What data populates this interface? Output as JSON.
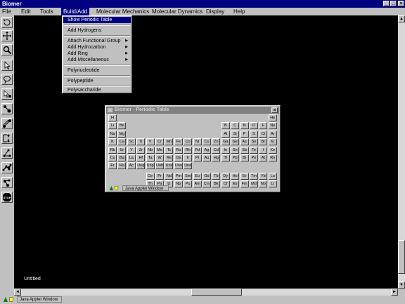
{
  "window": {
    "title": "Biomer"
  },
  "menubar": {
    "items": [
      "File",
      "Edit",
      "Tools",
      "Build/Add",
      "Molecular Mechanics",
      "Molecular Dynamics",
      "Display",
      "Help"
    ]
  },
  "dropdown": {
    "items": [
      {
        "label": "Show Periodic Table",
        "submenu": false,
        "highlighted": true
      },
      {
        "label": "Add Hydrogens",
        "submenu": false
      },
      {
        "label": "Attach Functional Group",
        "submenu": true
      },
      {
        "label": "Add Hydrocarbon",
        "submenu": true
      },
      {
        "label": "Add Ring",
        "submenu": true
      },
      {
        "label": "Add Miscellaneous",
        "submenu": true
      },
      {
        "label": "Polynucleotide",
        "submenu": false
      },
      {
        "label": "Polypeptide",
        "submenu": false
      },
      {
        "label": "Polysaccharide",
        "submenu": false
      }
    ]
  },
  "toolbar": {
    "tools": [
      "rotate-icon",
      "move-icon",
      "zoom-icon",
      "select-arrow-icon",
      "lasso-select-icon",
      "select-atom-icon",
      "add-atom-icon",
      "edit-bond-icon",
      "measure-distance-icon",
      "measure-angle-icon",
      "measure-torsion-icon",
      "molecule-icon",
      "stop-icon"
    ]
  },
  "toolbar_icon_text": {
    "stop": "STOP"
  },
  "canvas": {
    "document_name": "Untitled",
    "background": "#000000"
  },
  "status": {
    "applet_label": "Java Applet Window"
  },
  "periodic_table": {
    "title": "Biomer - Periodic Table",
    "close": "×",
    "status_label": "Java Applet Window",
    "rows": [
      [
        "H",
        "",
        "",
        "",
        "",
        "",
        "",
        "",
        "",
        "",
        "",
        "",
        "",
        "",
        "",
        "",
        "",
        "He"
      ],
      [
        "Li",
        "Be",
        "",
        "",
        "",
        "",
        "",
        "",
        "",
        "",
        "",
        "",
        "B",
        "C",
        "N",
        "O",
        "F",
        "Ne"
      ],
      [
        "Na",
        "Mg",
        "",
        "",
        "",
        "",
        "",
        "",
        "",
        "",
        "",
        "",
        "Al",
        "Si",
        "P",
        "S",
        "Cl",
        "Ar"
      ],
      [
        "K",
        "Ca",
        "Sc",
        "Ti",
        "V",
        "Cr",
        "Mn",
        "Fe",
        "Co",
        "Ni",
        "Cu",
        "Zn",
        "Ga",
        "Ge",
        "As",
        "Se",
        "Br",
        "Kr"
      ],
      [
        "Rb",
        "Sr",
        "Y",
        "Zr",
        "Nb",
        "Mo",
        "Tc",
        "Ru",
        "Rh",
        "Pd",
        "Ag",
        "Cd",
        "In",
        "Sn",
        "Sb",
        "Te",
        "I",
        "Xe"
      ],
      [
        "Cs",
        "Ba",
        "La",
        "Hf",
        "Ta",
        "W",
        "Re",
        "Os",
        "Ir",
        "Pt",
        "Au",
        "Hg",
        "Tl",
        "Pb",
        "Bi",
        "Po",
        "At",
        "Rn"
      ],
      [
        "Fr",
        "Ra",
        "Ac",
        "Unq",
        "Unp",
        "Unh",
        "Uns",
        "Uno",
        "Une",
        "",
        "",
        "",
        "",
        "",
        "",
        "",
        "",
        ""
      ]
    ],
    "lanthanides": [
      "Ce",
      "Pr",
      "Nd",
      "Pm",
      "Sm",
      "Eu",
      "Gd",
      "Tb",
      "Dy",
      "Ho",
      "Er",
      "Tm",
      "Yb",
      "Lu"
    ],
    "actinides": [
      "Th",
      "Pa",
      "U",
      "Np",
      "Pu",
      "Am",
      "Cm",
      "Bk",
      "Cf",
      "Es",
      "Fm",
      "Md",
      "No",
      "Lr"
    ]
  },
  "scrollbars": {
    "up": "▲",
    "down": "▼",
    "left": "◄",
    "right": "►"
  },
  "window_controls": {
    "minimize": "_",
    "maximize": "□",
    "close": "×"
  },
  "colors": {
    "titlebar": "#000080",
    "menu_highlight": "#000080",
    "chrome": "#c0c0c0"
  }
}
